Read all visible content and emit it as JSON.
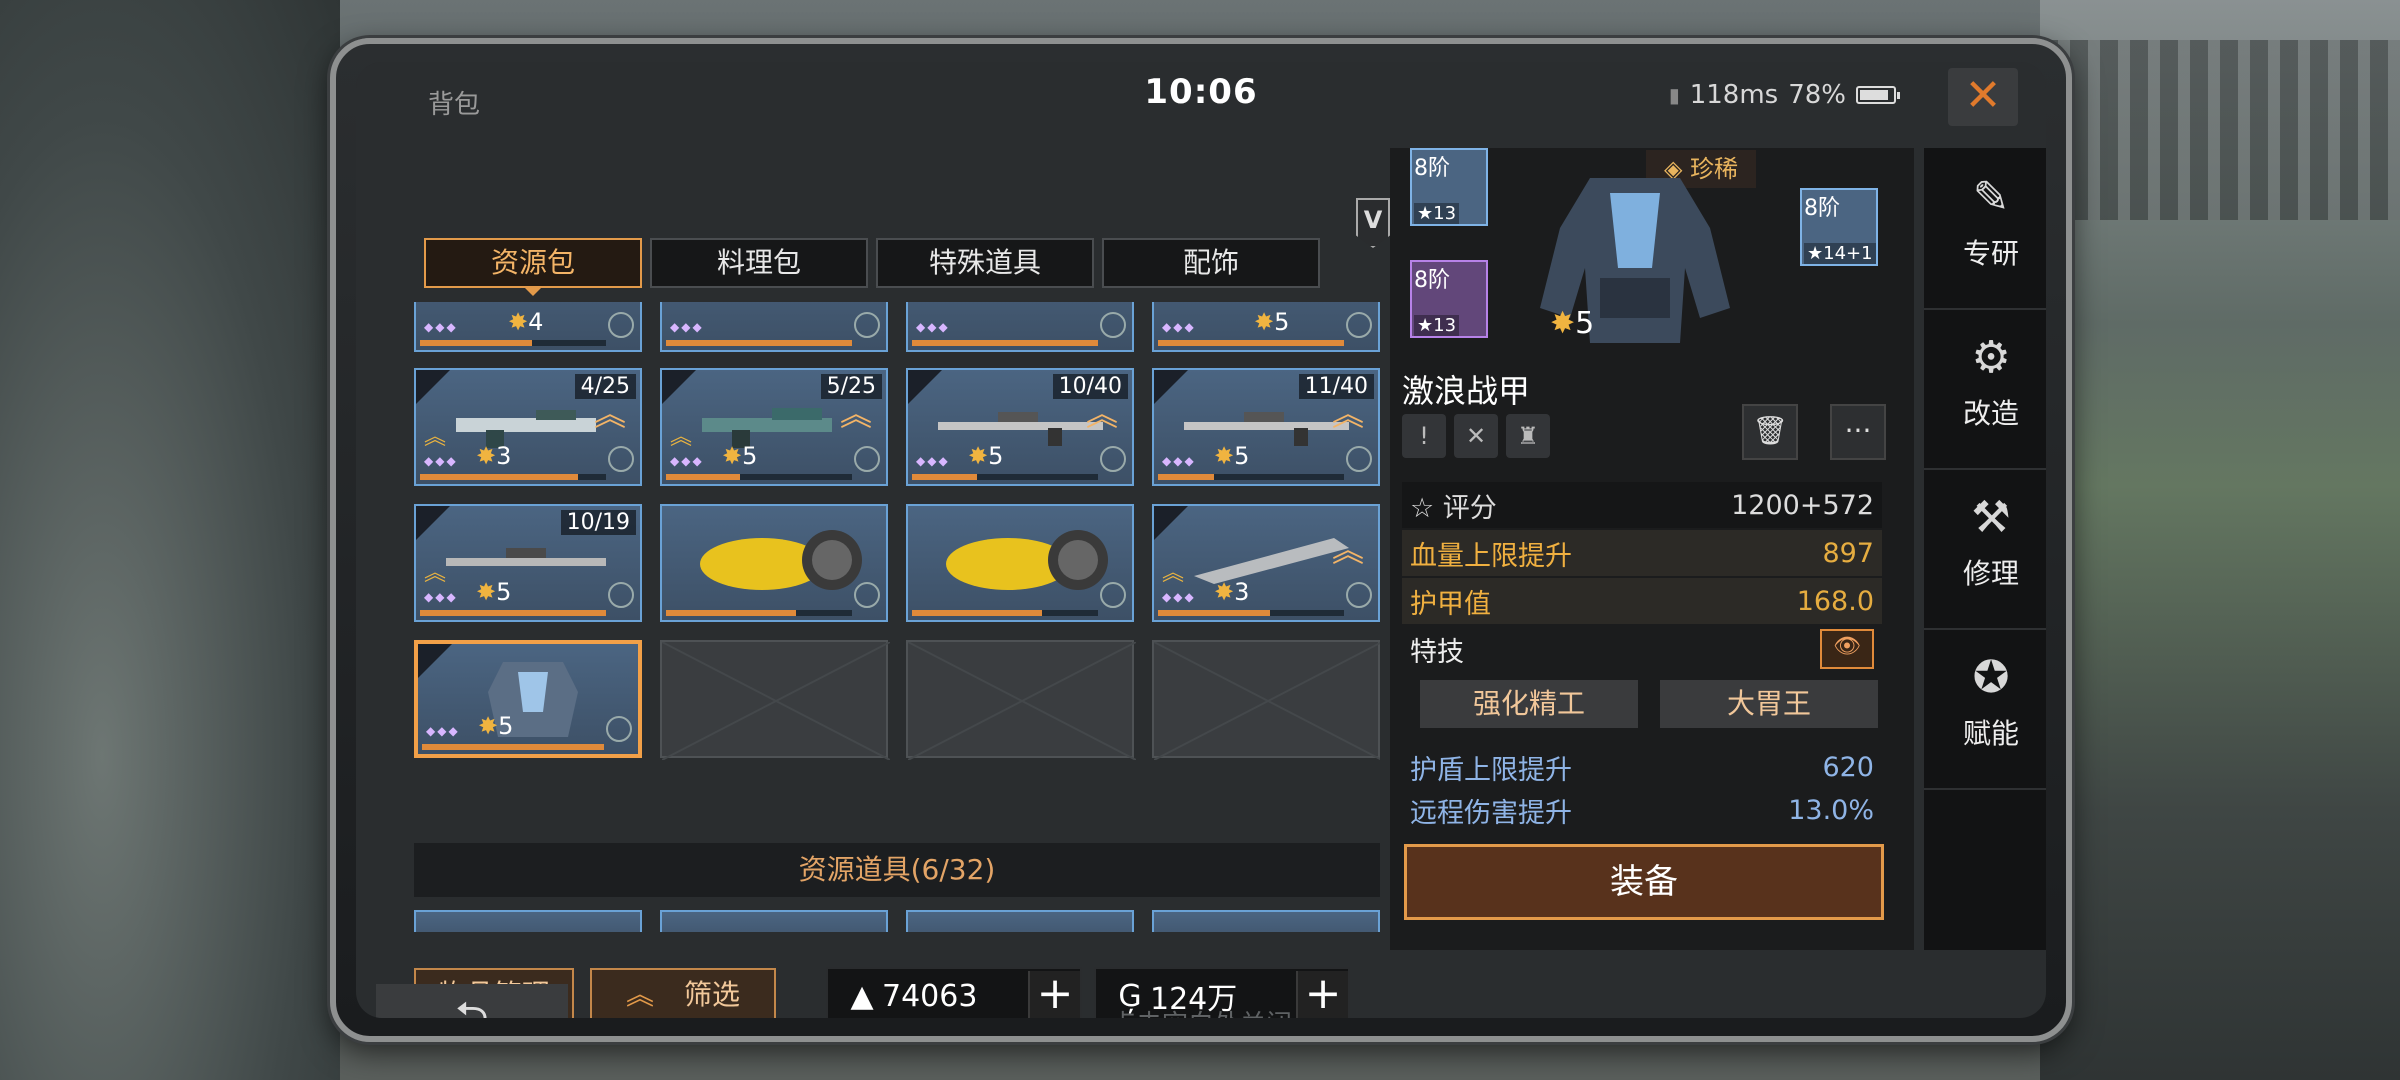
{
  "status": {
    "title": "背包",
    "clock": "10:06",
    "ping": "118ms",
    "battery": "78%"
  },
  "tabs": [
    "资源包",
    "料理包",
    "特殊道具",
    "配饰"
  ],
  "v_badge": "V",
  "grid": [
    {
      "row": 0,
      "items": [
        {
          "level": "4",
          "count": ""
        },
        {
          "level": "",
          "count": ""
        },
        {
          "level": "",
          "count": ""
        },
        {
          "level": "5",
          "count": ""
        }
      ]
    },
    {
      "row": 1,
      "items": [
        {
          "level": "3",
          "count": "4/25"
        },
        {
          "level": "5",
          "count": "5/25"
        },
        {
          "level": "5",
          "count": "10/40"
        },
        {
          "level": "5",
          "count": "11/40"
        }
      ]
    },
    {
      "row": 2,
      "items": [
        {
          "level": "5",
          "count": "10/19"
        },
        {
          "level": "",
          "count": ""
        },
        {
          "level": "",
          "count": ""
        },
        {
          "level": "3",
          "count": ""
        }
      ]
    },
    {
      "row": 3,
      "items": [
        {
          "level": "5",
          "count": ""
        }
      ]
    }
  ],
  "section_title": "资源道具(6/32)",
  "buttons": {
    "manage": "物品管理",
    "filter": "筛选"
  },
  "currency": [
    {
      "value": "74063"
    },
    {
      "value": "124万"
    }
  ],
  "hint": "点击空白处关闭",
  "detail": {
    "chips": [
      {
        "tier": "8阶",
        "stars": "13"
      },
      {
        "tier": "8阶",
        "stars": "13"
      },
      {
        "tier": "8阶",
        "stars": "14+1"
      }
    ],
    "rarity": "珍稀",
    "armor_level": "5",
    "name": "激浪战甲",
    "score_label": "评分",
    "score_value": "1200+572",
    "stats": [
      {
        "label": "血量上限提升",
        "value": "897"
      },
      {
        "label": "护甲值",
        "value": "168.0"
      }
    ],
    "skill_label": "特技",
    "skills": [
      "强化精工",
      "大胃王"
    ],
    "extra_stats": [
      {
        "label": "护盾上限提升",
        "value": "620"
      },
      {
        "label": "远程伤害提升",
        "value": "13.0%"
      }
    ],
    "equip": "装备"
  },
  "side_menu": [
    "专研",
    "改造",
    "修理",
    "赋能"
  ]
}
